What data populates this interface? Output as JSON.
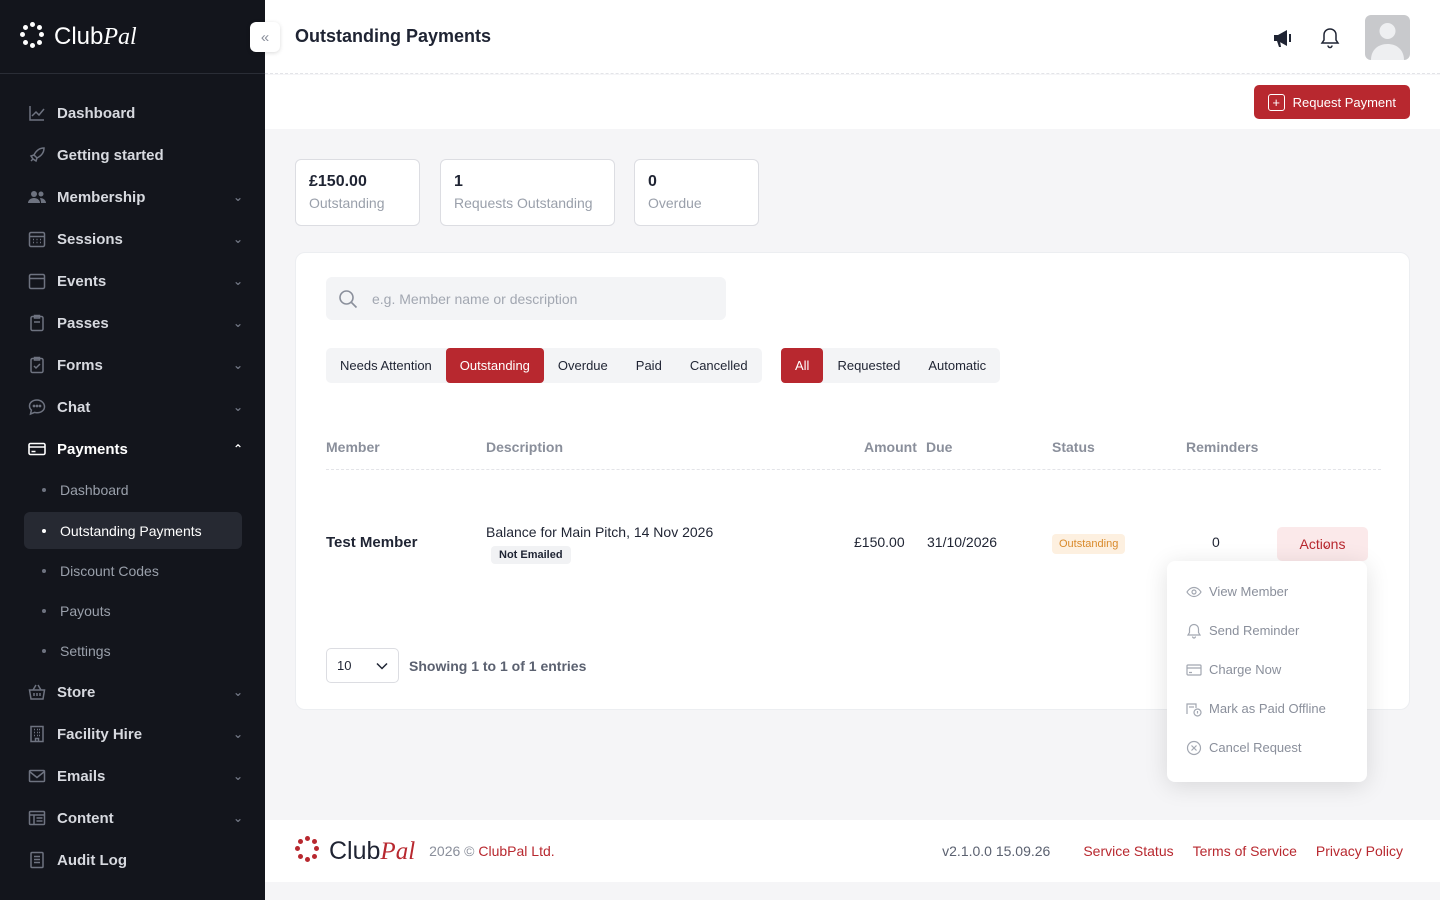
{
  "brand": {
    "name_a": "Club",
    "name_b": "Pal"
  },
  "colors": {
    "accent": "#b8282f",
    "sidebar_bg": "#13151c",
    "status_outstanding": "#d98a2b"
  },
  "sidebar": {
    "items": [
      {
        "label": "Dashboard",
        "icon": "chart-line-icon"
      },
      {
        "label": "Getting started",
        "icon": "rocket-icon"
      },
      {
        "label": "Membership",
        "icon": "users-icon"
      },
      {
        "label": "Sessions",
        "icon": "calendar-grid-icon"
      },
      {
        "label": "Events",
        "icon": "calendar-icon"
      },
      {
        "label": "Passes",
        "icon": "clipboard-icon"
      },
      {
        "label": "Forms",
        "icon": "form-icon"
      },
      {
        "label": "Chat",
        "icon": "chat-bubble-icon"
      },
      {
        "label": "Payments",
        "icon": "credit-card-icon"
      },
      {
        "label": "Store",
        "icon": "basket-icon"
      },
      {
        "label": "Facility Hire",
        "icon": "building-icon"
      },
      {
        "label": "Emails",
        "icon": "envelope-icon"
      },
      {
        "label": "Content",
        "icon": "layout-icon"
      },
      {
        "label": "Audit Log",
        "icon": "list-icon"
      }
    ],
    "payments_sub": [
      "Dashboard",
      "Outstanding Payments",
      "Discount Codes",
      "Payouts",
      "Settings"
    ]
  },
  "header": {
    "title": "Outstanding Payments"
  },
  "toolbar": {
    "request_label": "Request Payment"
  },
  "stats": [
    {
      "value": "£150.00",
      "label": "Outstanding"
    },
    {
      "value": "1",
      "label": "Requests Outstanding"
    },
    {
      "value": "0",
      "label": "Overdue"
    }
  ],
  "search": {
    "placeholder": "e.g. Member name or description",
    "value": ""
  },
  "status_filters": [
    "Needs Attention",
    "Outstanding",
    "Overdue",
    "Paid",
    "Cancelled"
  ],
  "type_filters": [
    "All",
    "Requested",
    "Automatic"
  ],
  "table": {
    "columns": [
      "Member",
      "Description",
      "Amount",
      "Due",
      "Status",
      "Reminders"
    ],
    "rows": [
      {
        "member": "Test Member",
        "description": "Balance for Main Pitch, 14 Nov 2026",
        "email_badge": "Not Emailed",
        "amount": "£150.00",
        "due": "31/10/2026",
        "status": "Outstanding",
        "reminders": "0",
        "actions_label": "Actions"
      }
    ]
  },
  "pager": {
    "page_size": "10",
    "info": "Showing 1 to 1 of 1 entries"
  },
  "actions_menu": [
    "View Member",
    "Send Reminder",
    "Charge Now",
    "Mark as Paid Offline",
    "Cancel Request"
  ],
  "footer": {
    "year": "2026 ©",
    "company": "ClubPal Ltd.",
    "version": "v2.1.0.0 15.09.26",
    "links": [
      "Service Status",
      "Terms of Service",
      "Privacy Policy"
    ]
  }
}
